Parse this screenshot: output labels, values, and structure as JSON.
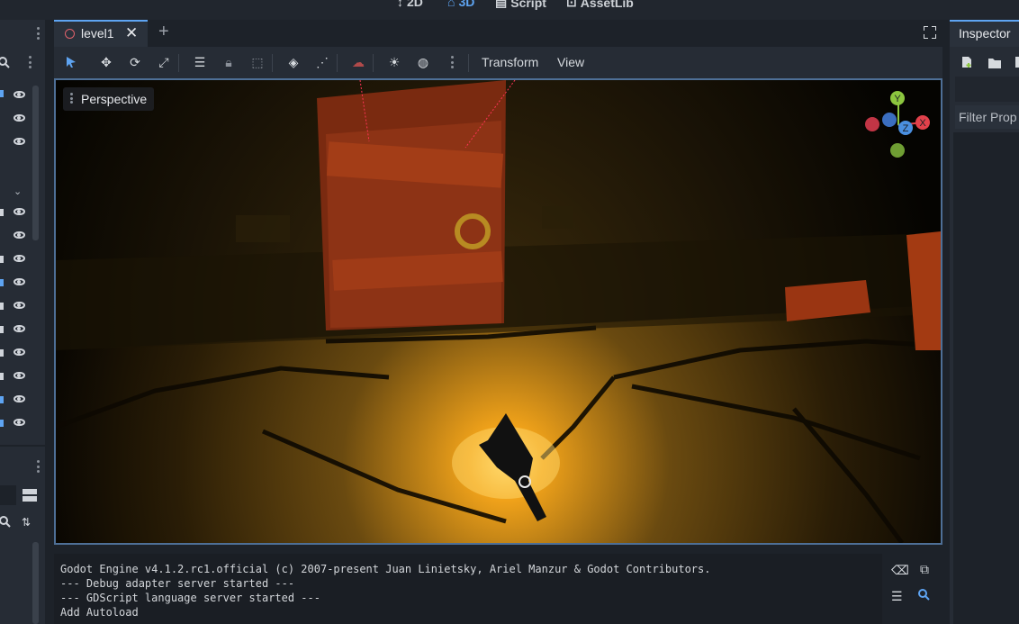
{
  "top_modes": [
    {
      "label": "2D",
      "active": false
    },
    {
      "label": "3D",
      "active": true
    },
    {
      "label": "Script",
      "active": false
    },
    {
      "label": "AssetLib",
      "active": false
    }
  ],
  "editor": {
    "scene_tab_label": "level1",
    "add_tab_symbol": "+",
    "toolbar_menus": {
      "transform": "Transform",
      "view": "View"
    },
    "viewport_mode": "Perspective",
    "gizmo_axes": {
      "x": "X",
      "y": "Y",
      "z": "Z"
    }
  },
  "inspector": {
    "title": "Inspector",
    "filter_placeholder": "Filter Prop"
  },
  "console": {
    "lines": [
      "Godot Engine v4.1.2.rc1.official (c) 2007-present Juan Linietsky, Ariel Manzur & Godot Contributors.",
      "--- Debug adapter server started ---",
      "--- GDScript language server started ---",
      "Add Autoload"
    ]
  },
  "colors": {
    "accent": "#5ea4f2",
    "axis_x": "#e2414b",
    "axis_y": "#8cc63f",
    "axis_z": "#4a8fe0"
  }
}
